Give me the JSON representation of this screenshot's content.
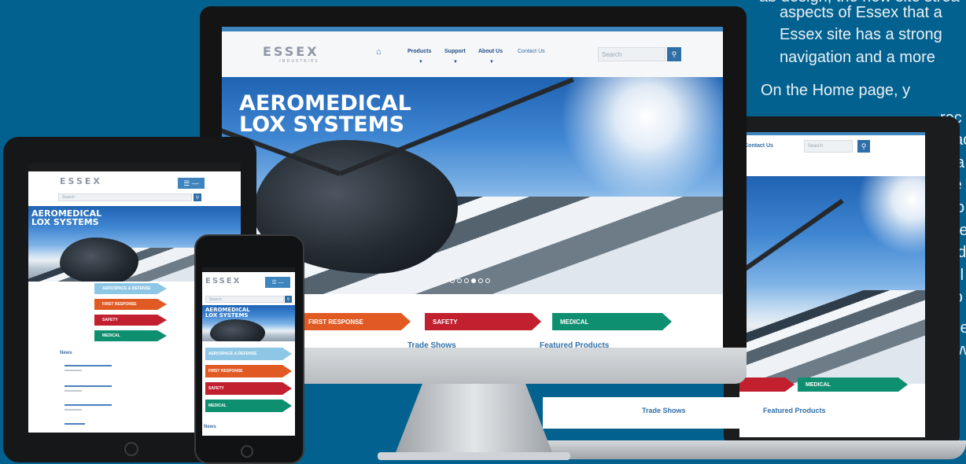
{
  "paragraph": {
    "lines": [
      "ab design, the new site strea",
      "aspects of Essex that a",
      "Essex site has a strong",
      "navigation and a more",
      "On the Home page, y",
      "rec",
      "Trad",
      "is a",
      "the",
      "Bro",
      "She",
      "und",
      "wel",
      "pro",
      "Che",
      "www"
    ]
  },
  "site": {
    "logo": "ESSEX",
    "logo_sub": "INDUSTRIES",
    "nav": {
      "home_icon": "home-icon",
      "items": [
        "Products",
        "Support",
        "About Us",
        "Contact Us"
      ]
    },
    "search_placeholder": "Search",
    "search_icon": "search-icon",
    "menu_icon": "hamburger-icon",
    "hero_title_line1": "AEROMEDICAL",
    "hero_title_line2": "LOX SYSTEMS",
    "carousel_dots": 6,
    "categories": [
      "AEROSPACE & DEFENSE",
      "FIRST RESPONSE",
      "SAFETY",
      "MEDICAL"
    ],
    "section_trade_shows": "Trade Shows",
    "section_featured": "Featured Products",
    "news_heading": "News"
  },
  "colors": {
    "background": "#03618f",
    "aerospace": "#8ec7e6",
    "first_response": "#e15a24",
    "safety": "#c21f2f",
    "medical": "#0e8f6f",
    "nav_blue": "#3e84bd"
  }
}
